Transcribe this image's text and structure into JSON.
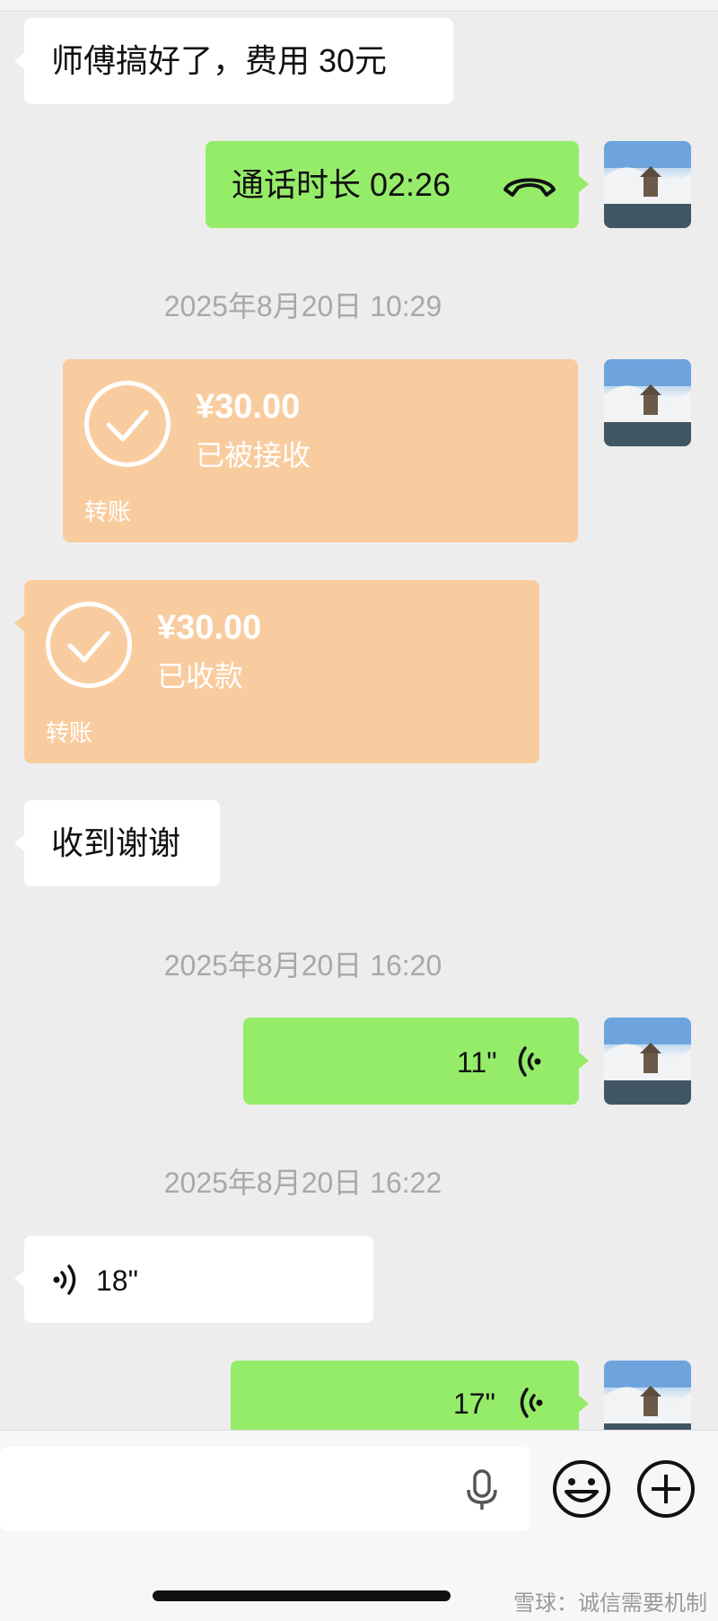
{
  "messages": {
    "m1_text": "师傅搞好了，费用 30元",
    "call_text": "通话时长 02:26",
    "ts1": "2025年8月20日 10:29",
    "transfer1": {
      "amount": "¥30.00",
      "status": "已被接收",
      "label": "转账"
    },
    "transfer2": {
      "amount": "¥30.00",
      "status": "已收款",
      "label": "转账"
    },
    "m2_text": "收到谢谢",
    "ts2": "2025年8月20日 16:20",
    "voice1_duration": "11\"",
    "ts3": "2025年8月20日 16:22",
    "voice2_duration": "18\"",
    "voice3_duration": "17\""
  },
  "watermark": "雪球：诚信需要机制",
  "icons": {
    "phone": "hangup-phone-icon",
    "voice": "voice-wave-icon",
    "mic": "microphone-icon",
    "emoji": "emoji-icon",
    "plus": "plus-icon",
    "check": "check-circle-icon"
  },
  "colors": {
    "background": "#ededed",
    "sent_bubble": "#95ec69",
    "received_bubble": "#ffffff",
    "transfer_bubble": "#f9cc9f",
    "timestamp": "#a8a8a8"
  }
}
